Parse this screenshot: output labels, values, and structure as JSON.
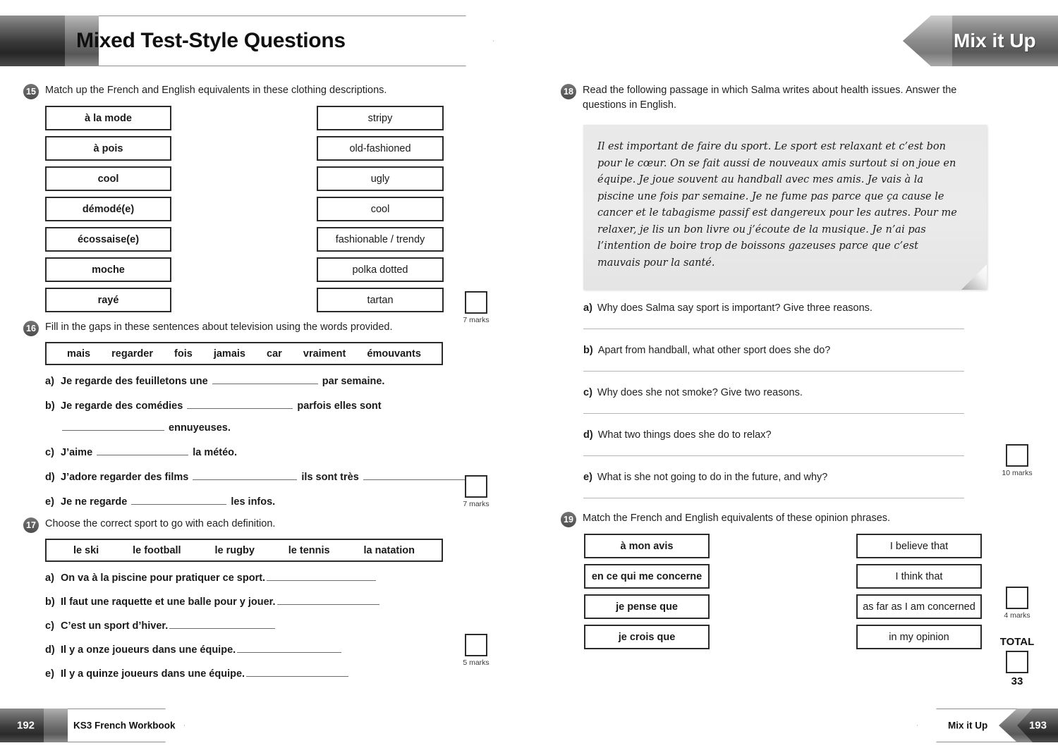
{
  "header": {
    "left_title": "Mixed Test-Style Questions",
    "right_title": "Mix it Up"
  },
  "footer": {
    "left_page": "192",
    "left_book": "KS3 French Workbook",
    "right_section": "Mix it Up",
    "right_page": "193"
  },
  "questions": {
    "q15": {
      "number": "15",
      "prompt": "Match up the French and English equivalents in these clothing descriptions.",
      "french": [
        "à la mode",
        "à pois",
        "cool",
        "démodé(e)",
        "écossaise(e)",
        "moche",
        "rayé"
      ],
      "english": [
        "stripy",
        "old-fashioned",
        "ugly",
        "cool",
        "fashionable / trendy",
        "polka dotted",
        "tartan"
      ],
      "marks": "7 marks"
    },
    "q16": {
      "number": "16",
      "prompt": "Fill in the gaps in these sentences about television using the words provided.",
      "wordbank": [
        "mais",
        "regarder",
        "fois",
        "jamais",
        "car",
        "vraiment",
        "émouvants"
      ],
      "items": [
        {
          "label": "a)",
          "pre": "Je regarde des feuilletons une ",
          "blank1": 150,
          "post": " par semaine.",
          "blank2": 0,
          "post2": ""
        },
        {
          "label": "b)",
          "pre": "Je regarde des comédies ",
          "blank1": 150,
          "post": " parfois elles sont",
          "blank2": 0,
          "post2": ""
        },
        {
          "label": "c)",
          "pre": "J’aime ",
          "blank1": 130,
          "post": " la météo.",
          "blank2": 0,
          "post2": ""
        },
        {
          "label": "d)",
          "pre": "J’adore regarder des films ",
          "blank1": 148,
          "post": " ils sont très ",
          "blank2": 145,
          "post2": "."
        },
        {
          "label": "e)",
          "pre": "Je ne regarde ",
          "blank1": 135,
          "post": " les infos.",
          "blank2": 0,
          "post2": ""
        }
      ],
      "b_continuation": {
        "blank": 145,
        "text": " ennuyeuses."
      },
      "marks": "7 marks"
    },
    "q17": {
      "number": "17",
      "prompt": "Choose the correct sport to go with each definition.",
      "wordbank": [
        "le ski",
        "le football",
        "le rugby",
        "le tennis",
        "la natation"
      ],
      "items": [
        {
          "label": "a)",
          "text": "On va à la piscine pour pratiquer ce sport.",
          "blank": 155
        },
        {
          "label": "b)",
          "text": "Il faut une raquette et une balle pour y jouer.",
          "blank": 145
        },
        {
          "label": "c)",
          "text": "C’est un sport d’hiver.",
          "blank": 150
        },
        {
          "label": "d)",
          "text": "Il y a onze joueurs dans une équipe.",
          "blank": 148
        },
        {
          "label": "e)",
          "text": "Il y a quinze joueurs dans une équipe.",
          "blank": 145
        }
      ],
      "marks": "5 marks"
    },
    "q18": {
      "number": "18",
      "prompt": "Read the following passage in which Salma writes about health issues. Answer the questions in English.",
      "passage": "Il est important de faire du sport. Le sport est relaxant et c’est bon pour le cœur. On se fait aussi de nouveaux amis surtout si on joue en équipe. Je joue souvent au handball avec mes amis. Je vais à la piscine une fois par semaine. Je ne fume pas parce que ça cause le cancer et le tabagisme passif est dangereux pour les autres. Pour me relaxer, je lis un bon livre ou j’écoute de la musique. Je n’ai pas l’intention de boire trop de boissons gazeuses parce que c’est mauvais pour la santé.",
      "items": [
        {
          "label": "a)",
          "text": "Why does Salma say sport is important? Give three reasons."
        },
        {
          "label": "b)",
          "text": "Apart from handball, what other sport does she do?"
        },
        {
          "label": "c)",
          "text": "Why does she not smoke? Give two reasons."
        },
        {
          "label": "d)",
          "text": "What two things does she do to relax?"
        },
        {
          "label": "e)",
          "text": "What is she not going to do in the future, and why?"
        }
      ],
      "marks": "10 marks"
    },
    "q19": {
      "number": "19",
      "prompt": "Match the French and English equivalents of these opinion phrases.",
      "french": [
        "à mon avis",
        "en ce qui me concerne",
        "je pense que",
        "je crois que"
      ],
      "english": [
        "I believe that",
        "I think that",
        "as far as I am concerned",
        "in my opinion"
      ],
      "marks": "4 marks"
    }
  },
  "total": {
    "label": "TOTAL",
    "value": "33"
  }
}
